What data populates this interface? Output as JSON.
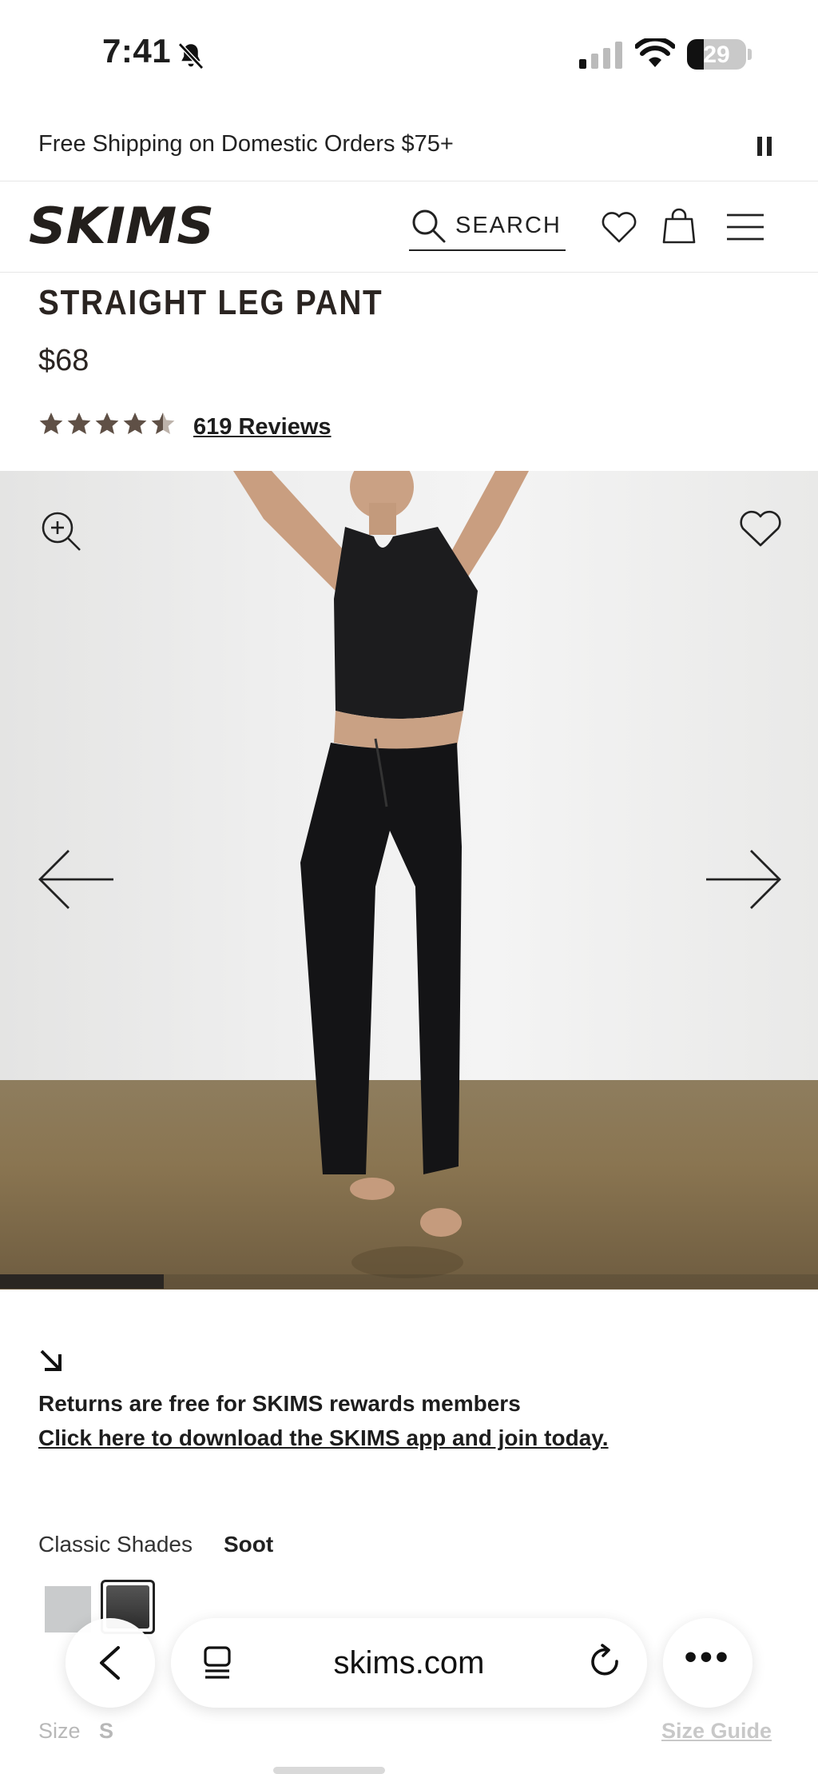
{
  "status_bar": {
    "time": "7:41",
    "battery": "29",
    "battery_level": 0.29,
    "icons": [
      "bell-slash-icon",
      "cellular-signal-icon",
      "wifi-icon",
      "battery-icon"
    ]
  },
  "promo": {
    "text": "Free Shipping on Domestic Orders $75+",
    "pause_icon": "pause-icon"
  },
  "header": {
    "logo": "SKIMS",
    "search_label": "SEARCH",
    "icons": [
      "search-icon",
      "heart-icon",
      "shopping-bag-icon",
      "menu-icon"
    ]
  },
  "product": {
    "title": "STRAIGHT LEG PANT",
    "price": "$68",
    "rating": 4.5,
    "reviews_link": "619 Reviews"
  },
  "gallery": {
    "icons": [
      "zoom-in-icon",
      "heart-outline-icon",
      "arrow-left-icon",
      "arrow-right-icon"
    ],
    "progress": 0.2
  },
  "returns": {
    "line1": "Returns are free for SKIMS rewards members",
    "line2": "Click here to download the SKIMS app and join today."
  },
  "shades": {
    "label": "Classic Shades",
    "selected": "Soot",
    "swatches": [
      {
        "name": "light-gray",
        "color": "#c9cbcc"
      },
      {
        "name": "Soot",
        "color": "#3a3a3a"
      }
    ]
  },
  "size": {
    "label": "Size",
    "selected": "S",
    "guide_link": "Size Guide"
  },
  "safari": {
    "url": "skims.com",
    "more": "•••"
  }
}
